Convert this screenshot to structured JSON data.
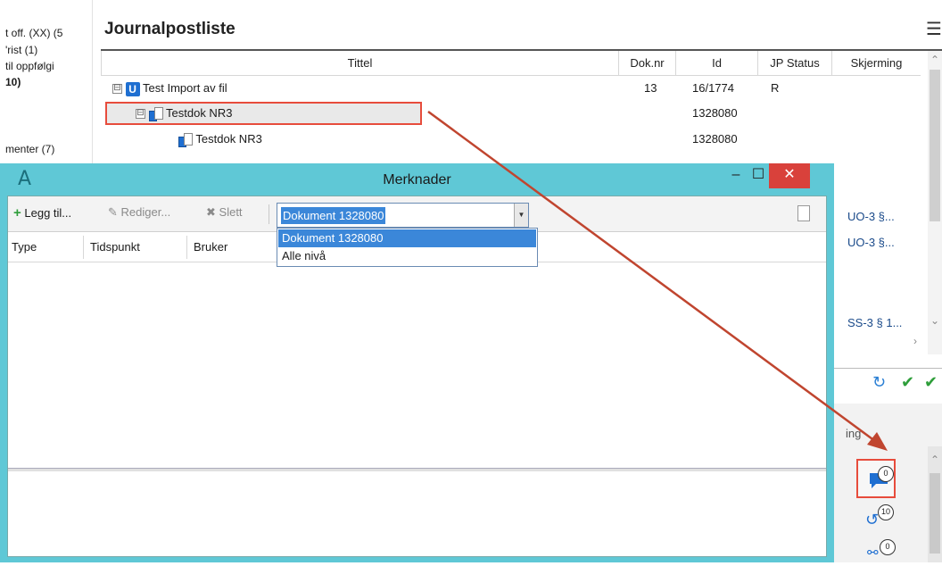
{
  "left_panel": {
    "items": [
      {
        "label": "t off. (XX) (5"
      },
      {
        "label": "'rist (1)"
      },
      {
        "label": "til oppfølgi"
      },
      {
        "label": "10)"
      },
      {
        "label": "menter (7)"
      }
    ]
  },
  "journal": {
    "title": "Journalpostliste",
    "menu_icon": "hamburger-icon",
    "columns": [
      "Tittel",
      "Dok.nr",
      "Id",
      "JP Status",
      "Skjerming"
    ],
    "rows": [
      {
        "expander": "⊟",
        "icon": "u-icon",
        "icon_text": "U",
        "title": "Test Import av fil",
        "doknr": "13",
        "id": "16/1774",
        "status": "R",
        "skjerming": ""
      },
      {
        "expander": "⊟",
        "icon": "document-icon",
        "title": "Testdok NR3",
        "doknr": "",
        "id": "1328080",
        "status": "",
        "skjerming": ""
      },
      {
        "expander": "",
        "icon": "document-icon",
        "title": "Testdok NR3",
        "doknr": "",
        "id": "1328080",
        "status": "",
        "skjerming": ""
      }
    ],
    "skjerming_values": [
      "UO-3 §...",
      "UO-3 §...",
      "SS-3 § 1..."
    ]
  },
  "action_bar": {
    "refresh_icon": "refresh-icon",
    "check_icon": "check-icon",
    "check_all_icon": "check-all-icon"
  },
  "side_panel": {
    "text": "ing",
    "buttons": [
      {
        "icon": "comment-icon",
        "count": "0"
      },
      {
        "icon": "history-icon",
        "count": "10"
      },
      {
        "icon": "link-icon",
        "count": "0"
      }
    ]
  },
  "dialog": {
    "logo": "A",
    "title": "Merknader",
    "minimize": "–",
    "maximize": "☐",
    "close": "✕",
    "toolbar": {
      "add_label": "Legg til...",
      "edit_label": "Rediger...",
      "delete_label": "Slett"
    },
    "level_select": {
      "value": "Dokument 1328080",
      "options": [
        "Dokument 1328080",
        "Alle nivå"
      ]
    },
    "grid_columns": [
      "Type",
      "Tidspunkt",
      "Bruker"
    ]
  },
  "colors": {
    "dialog_frame": "#5fc8d6",
    "highlight_red": "#e74c3c",
    "arrow": "#c0452f",
    "selection_blue": "#3b87d9"
  }
}
